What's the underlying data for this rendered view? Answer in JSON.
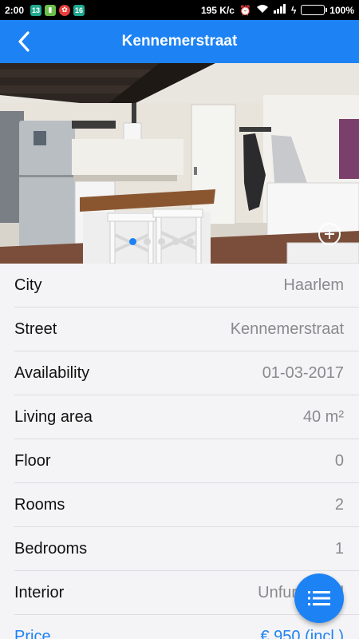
{
  "status": {
    "time": "2:00",
    "notif1": "13",
    "notif2": "16",
    "speed": "195 K/c",
    "battery": "100%"
  },
  "appbar": {
    "title": "Kennemerstraat"
  },
  "carousel": {
    "page_count": 5,
    "active_index": 0
  },
  "details": [
    {
      "label": "City",
      "value": "Haarlem"
    },
    {
      "label": "Street",
      "value": "Kennemerstraat"
    },
    {
      "label": "Availability",
      "value": "01-03-2017"
    },
    {
      "label": "Living area",
      "value": "40 m²"
    },
    {
      "label": "Floor",
      "value": "0"
    },
    {
      "label": "Rooms",
      "value": "2"
    },
    {
      "label": "Bedrooms",
      "value": "1"
    },
    {
      "label": "Interior",
      "value": "Unfurnished"
    },
    {
      "label": "Price",
      "value": "€ 950 (incl.)"
    }
  ],
  "colors": {
    "accent": "#1d82f4"
  }
}
